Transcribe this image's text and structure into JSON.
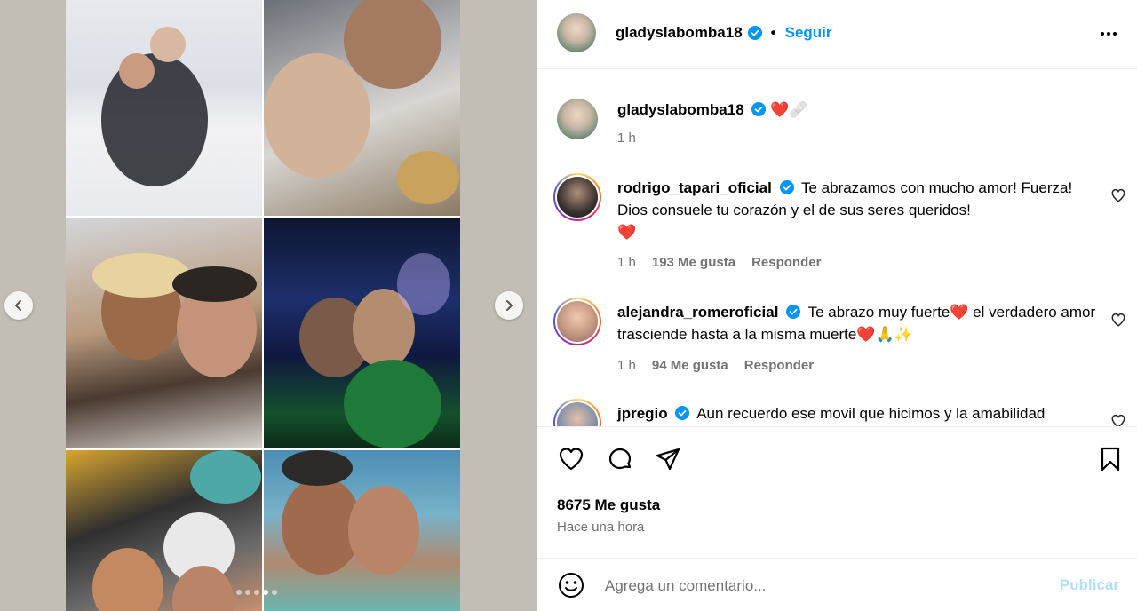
{
  "post": {
    "author": "gladyslabomba18",
    "follow_label": "Seguir",
    "separator": "•",
    "caption_emojis": "❤️🩹",
    "caption_time": "1 h"
  },
  "comments": [
    {
      "username": "rodrigo_tapari_oficial",
      "text": "Te abrazamos con mucho amor! Fuerza! Dios consuele tu corazón y el de sus seres queridos!",
      "emoji": "❤️",
      "time": "1 h",
      "likes": "193 Me gusta",
      "reply": "Responder"
    },
    {
      "username": "alejandra_romeroficial",
      "text_a": "Te abrazo muy fuerte",
      "text_b": " el verdadero amor trasciende hasta a la misma muerte",
      "emoji_a": "❤️",
      "emoji_b": "❤️🙏✨",
      "time": "1 h",
      "likes": "94 Me gusta",
      "reply": "Responder"
    },
    {
      "username": "jpregio",
      "text": "Aun recuerdo ese movil que hicimos y la amabilidad"
    }
  ],
  "stats": {
    "likes": "8675 Me gusta",
    "posted": "Hace una hora"
  },
  "composer": {
    "placeholder": "Agrega un comentario...",
    "publish_label": "Publicar"
  },
  "carousel": {
    "total_slides": 5,
    "active_slide": 4
  },
  "colors": {
    "link_blue": "#0095f6",
    "publish_disabled": "#b2dffc",
    "muted": "#737373",
    "verified": "#0095f6"
  }
}
